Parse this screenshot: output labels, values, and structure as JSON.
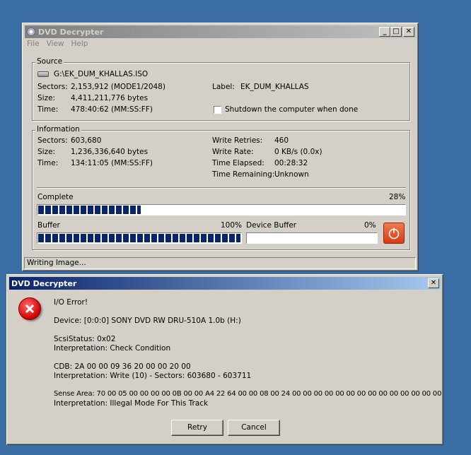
{
  "main_window": {
    "title": "DVD Decrypter",
    "menu": [
      "File",
      "View",
      "Help"
    ],
    "source": {
      "group_label": "Source",
      "file": "G:\\EK_DUM_KHALLAS.ISO",
      "sectors_label": "Sectors:",
      "sectors_value": "2,153,912 (MODE1/2048)",
      "size_label": "Size:",
      "size_value": "4,411,211,776 bytes",
      "time_label": "Time:",
      "time_value": "478:40:62 (MM:SS:FF)",
      "label_label": "Label:",
      "label_value": "EK_DUM_KHALLAS",
      "shutdown_label": "Shutdown the computer when done",
      "shutdown_checked": false
    },
    "information": {
      "group_label": "Information",
      "sectors_label": "Sectors:",
      "sectors_value": "603,680",
      "size_label": "Size:",
      "size_value": "1,236,336,640 bytes",
      "time_label": "Time:",
      "time_value": "134:11:05 (MM:SS:FF)",
      "write_retries_label": "Write Retries:",
      "write_retries_value": "460",
      "write_rate_label": "Write Rate:",
      "write_rate_value": "0 KB/s (0.0x)",
      "time_elapsed_label": "Time Elapsed:",
      "time_elapsed_value": "00:28:32",
      "time_remaining_label": "Time Remaining:",
      "time_remaining_value": "Unknown",
      "complete_label": "Complete",
      "complete_percent": "28%",
      "complete_fraction": 0.28,
      "buffer_label": "Buffer",
      "buffer_percent": "100%",
      "buffer_fraction": 1.0,
      "device_buffer_label": "Device Buffer",
      "device_buffer_percent": "0%",
      "device_buffer_fraction": 0.0
    },
    "status": "Writing Image..."
  },
  "error_dialog": {
    "title": "DVD Decrypter",
    "lines": {
      "l1": "I/O Error!",
      "l2": "Device: [0:0:0] SONY DVD RW DRU-510A 1.0b (H:)",
      "l3": "ScsiStatus: 0x02",
      "l4": "Interpretation: Check Condition",
      "l5": "CDB: 2A 00 00 09 36 20 00 00 20 00",
      "l6": "Interpretation: Write (10) - Sectors: 603680 - 603711",
      "l7": "Sense Area: 70 00 05 00 00 00 00 0B 00 00 A4 22 64 00 00 08 00 24 00 00 00 00 00 00 00 00 00 00 00 00 00 00",
      "l8": "Interpretation: Illegal Mode For This Track"
    },
    "retry_label": "Retry",
    "cancel_label": "Cancel"
  }
}
